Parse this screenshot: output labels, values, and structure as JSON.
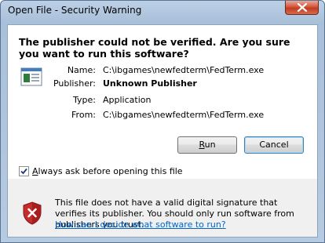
{
  "window": {
    "title": "Open File - Security Warning",
    "close_icon": "close-icon"
  },
  "dialog": {
    "heading": "The publisher could not be verified.  Are you sure you want to run this software?",
    "app_icon": "application-icon",
    "details": [
      {
        "label": "Name:",
        "value": "C:\\ibgames\\newfedterm\\FedTerm.exe"
      },
      {
        "label": "Publisher:",
        "value": "Unknown Publisher"
      },
      {
        "label": "Type:",
        "value": "Application"
      },
      {
        "label": "From:",
        "value": "C:\\ibgames\\newfedterm\\FedTerm.exe"
      }
    ],
    "buttons": {
      "run_label_accel": "R",
      "run_label_rest": "un",
      "cancel_label": "Cancel"
    },
    "checkbox": {
      "checked": true,
      "label_pre": "",
      "label_accel": "A",
      "label_rest": "lways ask before opening this file"
    },
    "warning": {
      "icon": "shield-error-icon",
      "text": "This file does not have a valid digital signature that verifies its publisher.  You should only run software from publishers you trust.",
      "link": "How can I decide what software to run?"
    }
  }
}
